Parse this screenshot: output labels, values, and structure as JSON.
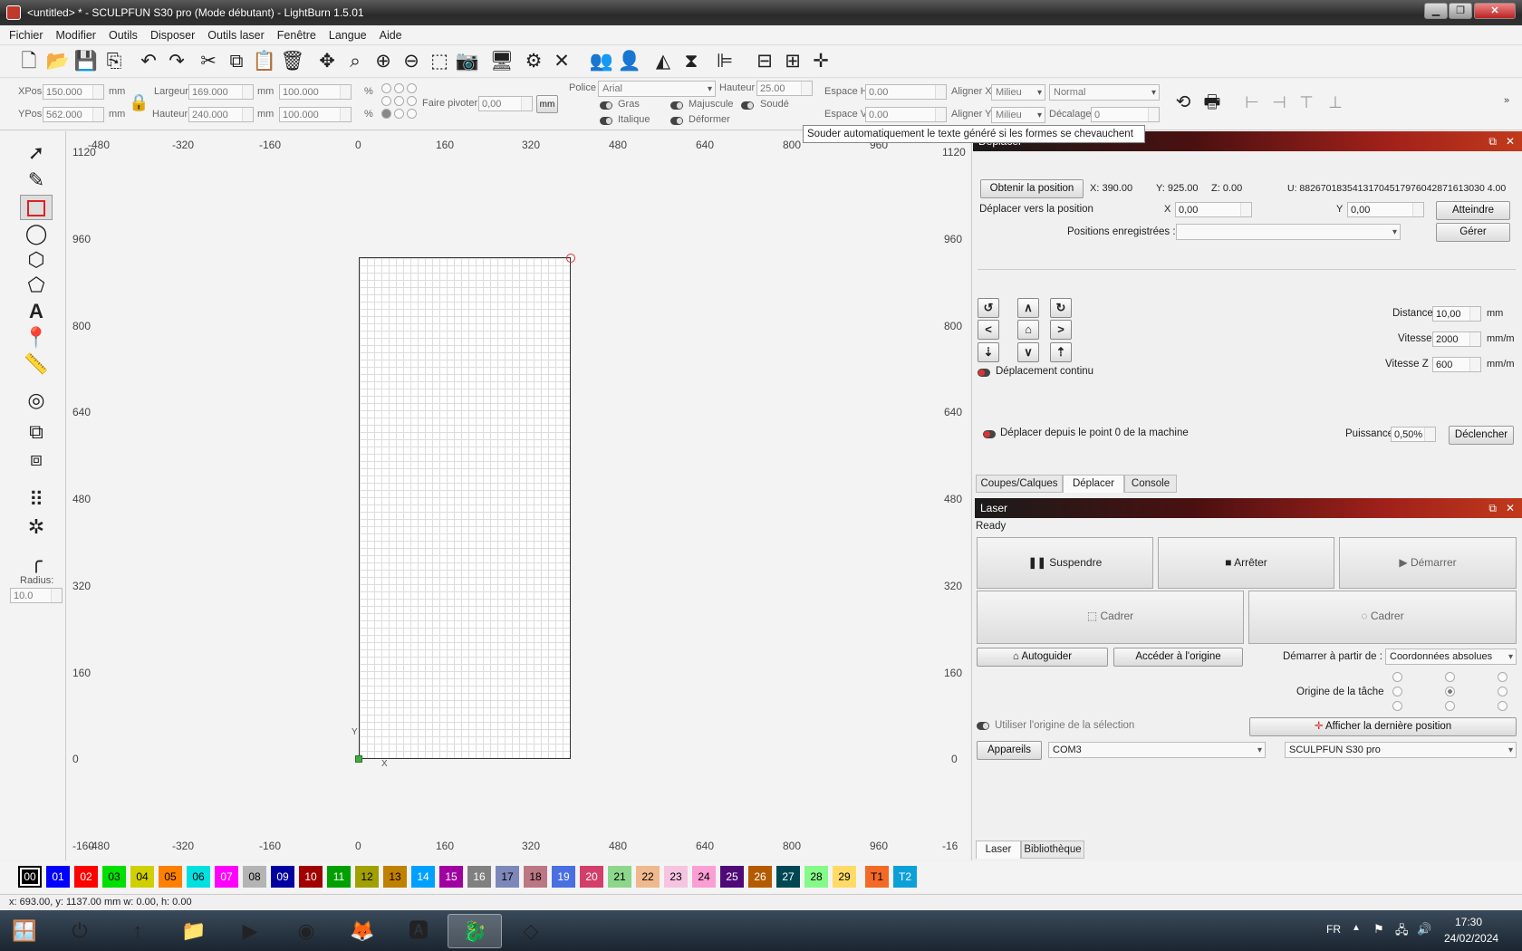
{
  "window": {
    "title": "<untitled> * - SCULPFUN S30 pro (Mode débutant) - LightBurn 1.5.01"
  },
  "menu": [
    "Fichier",
    "Modifier",
    "Outils",
    "Disposer",
    "Outils laser",
    "Fenêtre",
    "Langue",
    "Aide"
  ],
  "props": {
    "xpos_label": "XPos",
    "xpos": "150.000",
    "ypos_label": "YPos",
    "ypos": "562.000",
    "unit_mm": "mm",
    "width_label": "Largeur",
    "width": "169.000",
    "height_label": "Hauteur",
    "height": "240.000",
    "pct_w": "100.000",
    "pct_h": "100.000",
    "pct": "%",
    "rotate_label": "Faire pivoter",
    "rotate": "0,00",
    "mm_btn": "mm",
    "font_label": "Police",
    "font": "Arial",
    "fheight_label": "Hauteur",
    "fheight": "25.00",
    "bold": "Gras",
    "upper": "Majuscule",
    "weld": "Soudé",
    "italic": "Italique",
    "distort": "Déformer",
    "hspace_label": "Espace H",
    "hspace": "0.00",
    "vspace_label": "Espace V",
    "vspace": "0.00",
    "alignx_label": "Aligner X",
    "alignx": "Milieu",
    "aligny_label": "Aligner Y",
    "aligny": "Milieu",
    "mode": "Normal",
    "offset_label": "Décalage",
    "offset": "0"
  },
  "tooltip": "Souder automatiquement le texte généré si les formes se chevauchent",
  "tools": {
    "radius_label": "Radius:",
    "radius": "10.0"
  },
  "ruler": {
    "top": [
      "-480",
      "-320",
      "-160",
      "0",
      "160",
      "320",
      "480",
      "640",
      "800",
      "960",
      "11"
    ],
    "left": [
      "1120",
      "960",
      "800",
      "640",
      "480",
      "320",
      "160",
      "0",
      "-160"
    ],
    "right": [
      "1120",
      "960",
      "800",
      "640",
      "480",
      "320",
      "160",
      "0",
      "-16"
    ],
    "bottom": [
      "-480",
      "-320",
      "-160",
      "0",
      "160",
      "320",
      "480",
      "640",
      "800",
      "960"
    ],
    "y_axis": "Y",
    "x_axis": "X"
  },
  "move": {
    "title": "Déplacer",
    "get_position": "Obtenir la position",
    "x": "X: 390.00",
    "y": "Y: 925.00",
    "z": "Z: 0.00",
    "u": "U: 88267018354131704517976042871613030 4.00",
    "move_to": "Déplacer vers la position",
    "x_label": "X",
    "x_val": "0,00",
    "y_label": "Y",
    "y_val": "0,00",
    "goto": "Atteindre",
    "saved_label": "Positions enregistrées :",
    "manage": "Gérer",
    "distance_label": "Distance",
    "distance": "10,00",
    "distance_unit": "mm",
    "speed_label": "Vitesse",
    "speed": "2000",
    "speed_unit": "mm/m",
    "zspeed_label": "Vitesse Z",
    "zspeed": "600",
    "zspeed_unit": "mm/m",
    "continuous": "Déplacement continu",
    "from_zero": "Déplacer depuis le point 0 de la machine",
    "power_label": "Puissance",
    "power": "0,50%",
    "fire": "Déclencher"
  },
  "tabs1": [
    "Coupes/Calques",
    "Déplacer",
    "Console"
  ],
  "laser": {
    "title": "Laser",
    "status": "Ready",
    "pause": "Suspendre",
    "stop": "Arrêter",
    "start": "Démarrer",
    "frame1": "Cadrer",
    "frame2": "Cadrer",
    "home": "Autoguider",
    "origin": "Accéder à l'origine",
    "start_from_label": "Démarrer à partir de :",
    "start_from": "Coordonnées absolues",
    "job_origin": "Origine de la tâche",
    "use_sel_origin": "Utiliser l'origine de la sélection",
    "last_pos": "Afficher la dernière position",
    "devices": "Appareils",
    "port": "COM3",
    "device": "SCULPFUN S30 pro"
  },
  "tabs2": [
    "Laser",
    "Bibliothèque"
  ],
  "palette": [
    {
      "l": "00",
      "c": "#000000",
      "t": "#ffffff"
    },
    {
      "l": "01",
      "c": "#0000ff",
      "t": "#ffffff"
    },
    {
      "l": "02",
      "c": "#ff0000",
      "t": "#ffffff"
    },
    {
      "l": "03",
      "c": "#00e000",
      "t": "#000000"
    },
    {
      "l": "04",
      "c": "#d0d000",
      "t": "#000000"
    },
    {
      "l": "05",
      "c": "#ff8000",
      "t": "#000000"
    },
    {
      "l": "06",
      "c": "#00e0e0",
      "t": "#000000"
    },
    {
      "l": "07",
      "c": "#ff00ff",
      "t": "#ffffff"
    },
    {
      "l": "08",
      "c": "#b4b4b4",
      "t": "#000000"
    },
    {
      "l": "09",
      "c": "#0000a0",
      "t": "#ffffff"
    },
    {
      "l": "10",
      "c": "#a00000",
      "t": "#ffffff"
    },
    {
      "l": "11",
      "c": "#00a000",
      "t": "#ffffff"
    },
    {
      "l": "12",
      "c": "#a0a000",
      "t": "#000000"
    },
    {
      "l": "13",
      "c": "#c08000",
      "t": "#000000"
    },
    {
      "l": "14",
      "c": "#00a0ff",
      "t": "#ffffff"
    },
    {
      "l": "15",
      "c": "#a000a0",
      "t": "#ffffff"
    },
    {
      "l": "16",
      "c": "#808080",
      "t": "#ffffff"
    },
    {
      "l": "17",
      "c": "#7d87b9",
      "t": "#000000"
    },
    {
      "l": "18",
      "c": "#bb7784",
      "t": "#000000"
    },
    {
      "l": "19",
      "c": "#4a6fe3",
      "t": "#ffffff"
    },
    {
      "l": "20",
      "c": "#d33f6a",
      "t": "#ffffff"
    },
    {
      "l": "21",
      "c": "#8cd78c",
      "t": "#000000"
    },
    {
      "l": "22",
      "c": "#f0b98d",
      "t": "#000000"
    },
    {
      "l": "23",
      "c": "#f6c4e1",
      "t": "#000000"
    },
    {
      "l": "24",
      "c": "#fa9ed4",
      "t": "#000000"
    },
    {
      "l": "25",
      "c": "#500a78",
      "t": "#ffffff"
    },
    {
      "l": "26",
      "c": "#b45a00",
      "t": "#ffffff"
    },
    {
      "l": "27",
      "c": "#004754",
      "t": "#ffffff"
    },
    {
      "l": "28",
      "c": "#86fa88",
      "t": "#000000"
    },
    {
      "l": "29",
      "c": "#ffdb66",
      "t": "#000000"
    },
    {
      "l": "T1",
      "c": "#f36926",
      "t": "#000000"
    },
    {
      "l": "T2",
      "c": "#0ca0d9",
      "t": "#ffffff"
    }
  ],
  "status": "x: 693.00, y: 1137.00 mm  w: 0.00,  h: 0.00",
  "tray": {
    "lang": "FR",
    "time": "17:30",
    "date": "24/02/2024"
  }
}
